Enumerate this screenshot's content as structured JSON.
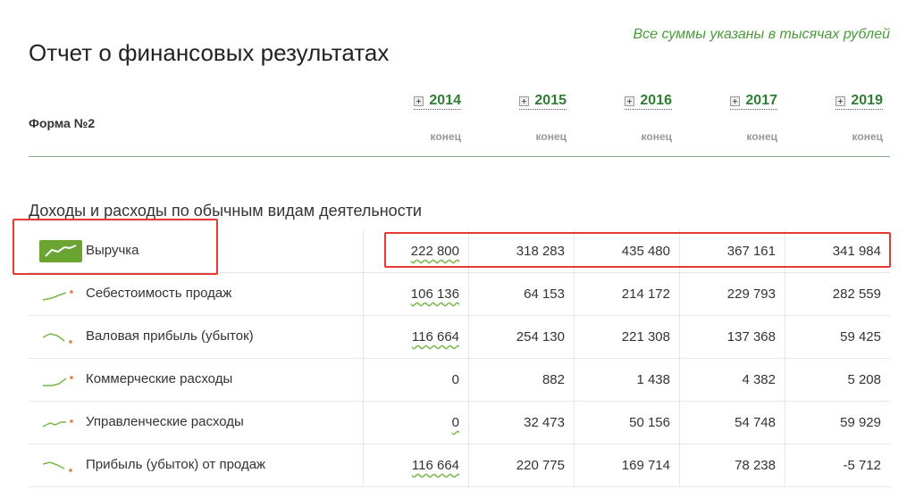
{
  "header": {
    "title": "Отчет о финансовых результатах",
    "note": "Все суммы указаны в тысячах рублей",
    "form_label": "Форма №2"
  },
  "columns": [
    {
      "year": "2014",
      "period": "конец"
    },
    {
      "year": "2015",
      "period": "конец"
    },
    {
      "year": "2016",
      "period": "конец"
    },
    {
      "year": "2017",
      "period": "конец"
    },
    {
      "year": "2019",
      "period": "конец"
    }
  ],
  "section": {
    "title": "Доходы и расходы по обычным видам деятельности"
  },
  "rows": [
    {
      "label": "Выручка",
      "values": [
        "222 800",
        "318 283",
        "435 480",
        "367 161",
        "341 984"
      ],
      "icon": "trend-up-icon",
      "highlighted": true
    },
    {
      "label": "Себестоимость продаж",
      "values": [
        "106 136",
        "64 153",
        "214 172",
        "229 793",
        "282 559"
      ],
      "icon": "trend-sparkline-icon"
    },
    {
      "label": "Валовая прибыль (убыток)",
      "values": [
        "116 664",
        "254 130",
        "221 308",
        "137 368",
        "59 425"
      ],
      "icon": "trend-down-sparkline-icon"
    },
    {
      "label": "Коммерческие расходы",
      "values": [
        "0",
        "882",
        "1 438",
        "4 382",
        "5 208"
      ],
      "icon": "trend-sparkline-icon"
    },
    {
      "label": "Управленческие расходы",
      "values": [
        "0",
        "32 473",
        "50 156",
        "54 748",
        "59 929"
      ],
      "icon": "trend-sparkline-icon"
    },
    {
      "label": "Прибыль (убыток) от продаж",
      "values": [
        "116 664",
        "220 775",
        "169 714",
        "78 238",
        "-5 712"
      ],
      "icon": "trend-down-sparkline-icon"
    }
  ],
  "colors": {
    "accent_green": "#2f7d32",
    "note_green": "#4a9a3a",
    "sparkline_green": "#7ab648",
    "sparkline_dot": "#e07b39",
    "highlight_red": "#e53935"
  }
}
